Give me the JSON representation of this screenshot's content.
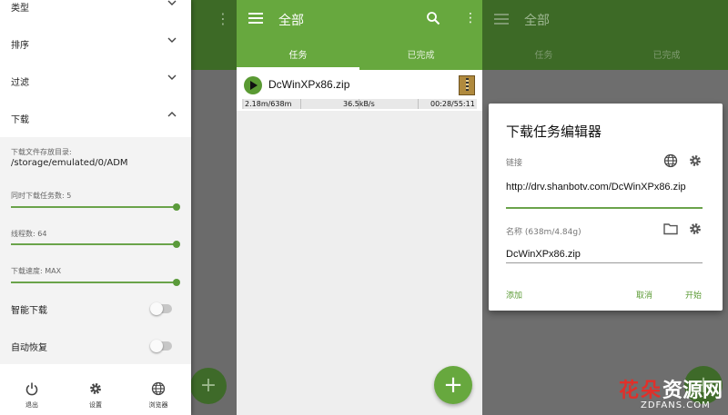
{
  "settings_panel": {
    "sections": [
      {
        "label": "类型",
        "expanded": false
      },
      {
        "label": "排序",
        "expanded": false
      },
      {
        "label": "过滤",
        "expanded": false
      },
      {
        "label": "下载",
        "expanded": true
      }
    ],
    "download_dir_label": "下载文件存放目录:",
    "download_dir_value": "/storage/emulated/0/ADM",
    "concurrent_label": "同时下载任务数: 5",
    "threads_label": "线程数: 64",
    "speed_label": "下载速度: MAX",
    "smart_download_label": "智能下载",
    "smart_download_on": false,
    "auto_resume_label": "自动恢复",
    "auto_resume_on": false,
    "bottom_nav": [
      {
        "label": "退出",
        "icon": "power-icon"
      },
      {
        "label": "设置",
        "icon": "gear-icon"
      },
      {
        "label": "浏览器",
        "icon": "globe-icon"
      }
    ]
  },
  "main_panel": {
    "title": "全部",
    "tabs": [
      {
        "label": "任务",
        "active": true
      },
      {
        "label": "已完成",
        "active": false
      }
    ],
    "task": {
      "filename": "DcWinXPx86.zip",
      "size_progress": "2.18m/638m",
      "speed": "36.5kB/s",
      "time": "00:28/55:11",
      "progress_fraction": 0.0034
    }
  },
  "dialog_panel": {
    "title": "全部",
    "tabs": [
      "任务",
      "已完成"
    ],
    "dialog_title": "下载任务编辑器",
    "link_label": "链接",
    "link_value": "http://drv.shanbotv.com/DcWinXPx86.zip",
    "name_label": "名称 (638m/4.84g)",
    "name_value": "DcWinXPx86.zip",
    "add_label": "添加",
    "cancel_label": "取消",
    "start_label": "开始"
  },
  "watermark": {
    "char1": "花",
    "char2": "朵",
    "text": "资源网",
    "url": "ZDFANS.COM"
  },
  "colors": {
    "primary": "#67a83e",
    "primary_dark_dimmed": "#3d6a26",
    "accent_green": "#5a9a33",
    "watermark_red": "#e0302a"
  }
}
